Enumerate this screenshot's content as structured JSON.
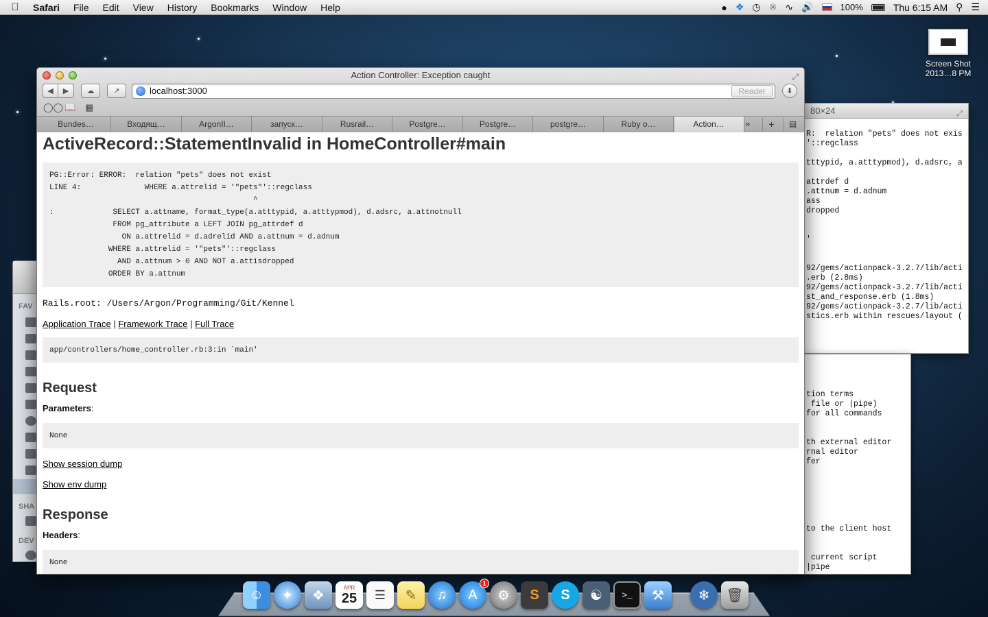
{
  "menubar": {
    "app": "Safari",
    "items": [
      "File",
      "Edit",
      "View",
      "History",
      "Bookmarks",
      "Window",
      "Help"
    ],
    "battery": "100%",
    "clock": "Thu 6:15 AM",
    "status_icons": [
      "evernote-icon",
      "dropbox-icon",
      "time-machine-icon",
      "bluetooth-icon",
      "wifi-icon",
      "volume-icon",
      "flag-ru-icon",
      "battery-icon",
      "spotlight-icon",
      "notification-center-icon"
    ]
  },
  "desktop": {
    "screenshot_label_1": "Screen Shot",
    "screenshot_label_2": "2013…8 PM"
  },
  "terminal": {
    "title_fragment": "80×24",
    "lines_top": [
      "R:  relation \"pets\" does not exis",
      "'::regclass",
      "",
      "tttypid, a.atttypmod), d.adsrc, a",
      "",
      "attrdef d",
      ".attnum = d.adnum",
      "ass",
      "dropped",
      "",
      "",
      "'",
      "",
      "",
      "92/gems/actionpack-3.2.7/lib/acti",
      ".erb (2.8ms)",
      "92/gems/actionpack-3.2.7/lib/acti",
      "st_and_response.erb (1.8ms)",
      "92/gems/actionpack-3.2.7/lib/acti",
      "stics.erb within rescues/layout ("
    ],
    "lines_bottom": [
      "tion terms",
      " file or |pipe)",
      "for all commands",
      "",
      "",
      "th external editor",
      "rnal editor",
      "fer",
      "",
      "",
      "",
      "",
      "",
      "",
      "to the client host",
      "",
      "",
      " current script",
      "|pipe"
    ]
  },
  "safari": {
    "window_title": "Action Controller: Exception caught",
    "address": "localhost:3000",
    "reader_label": "Reader",
    "tabs": [
      "Bundes…",
      "Входящ…",
      "ArgonII…",
      "запуск…",
      "Rusrail…",
      "Postgre…",
      "Postgre…",
      "postgre…",
      "Ruby o…",
      "Action…"
    ],
    "active_tab": 9
  },
  "page": {
    "title": "ActiveRecord::StatementInvalid in HomeController#main",
    "error_text": "PG::Error: ERROR:  relation \"pets\" does not exist\nLINE 4:              WHERE a.attrelid = '\"pets\"'::regclass\n                                             ^\n:             SELECT a.attname, format_type(a.atttypid, a.atttypmod), d.adsrc, a.attnotnull\n              FROM pg_attribute a LEFT JOIN pg_attrdef d\n                ON a.attrelid = d.adrelid AND a.attnum = d.adnum\n             WHERE a.attrelid = '\"pets\"'::regclass\n               AND a.attnum > 0 AND NOT a.attisdropped\n             ORDER BY a.attnum",
    "rails_root": "Rails.root: /Users/Argon/Programming/Git/Kennel",
    "trace_links": {
      "application": "Application Trace",
      "framework": "Framework Trace",
      "full": "Full Trace",
      "separator": " | "
    },
    "trace_text": "app/controllers/home_controller.rb:3:in `main'",
    "request_heading": "Request",
    "parameters_label": "Parameters",
    "parameters_value": "None",
    "show_session": "Show session dump",
    "show_env": "Show env dump",
    "response_heading": "Response",
    "headers_label": "Headers",
    "headers_value": "None"
  },
  "dock": {
    "calendar_month": "APR",
    "calendar_day": "25",
    "appstore_badge": "1",
    "apps": [
      "finder-icon",
      "safari-icon",
      "preview-icon",
      "calendar-icon",
      "reminders-icon",
      "notes-icon",
      "itunes-icon",
      "app-store-icon",
      "system-preferences-icon",
      "sublime-text-icon",
      "skype-icon",
      "github-icon",
      "terminal-icon",
      "xcode-icon",
      "postgres-icon",
      "trash-icon"
    ]
  }
}
